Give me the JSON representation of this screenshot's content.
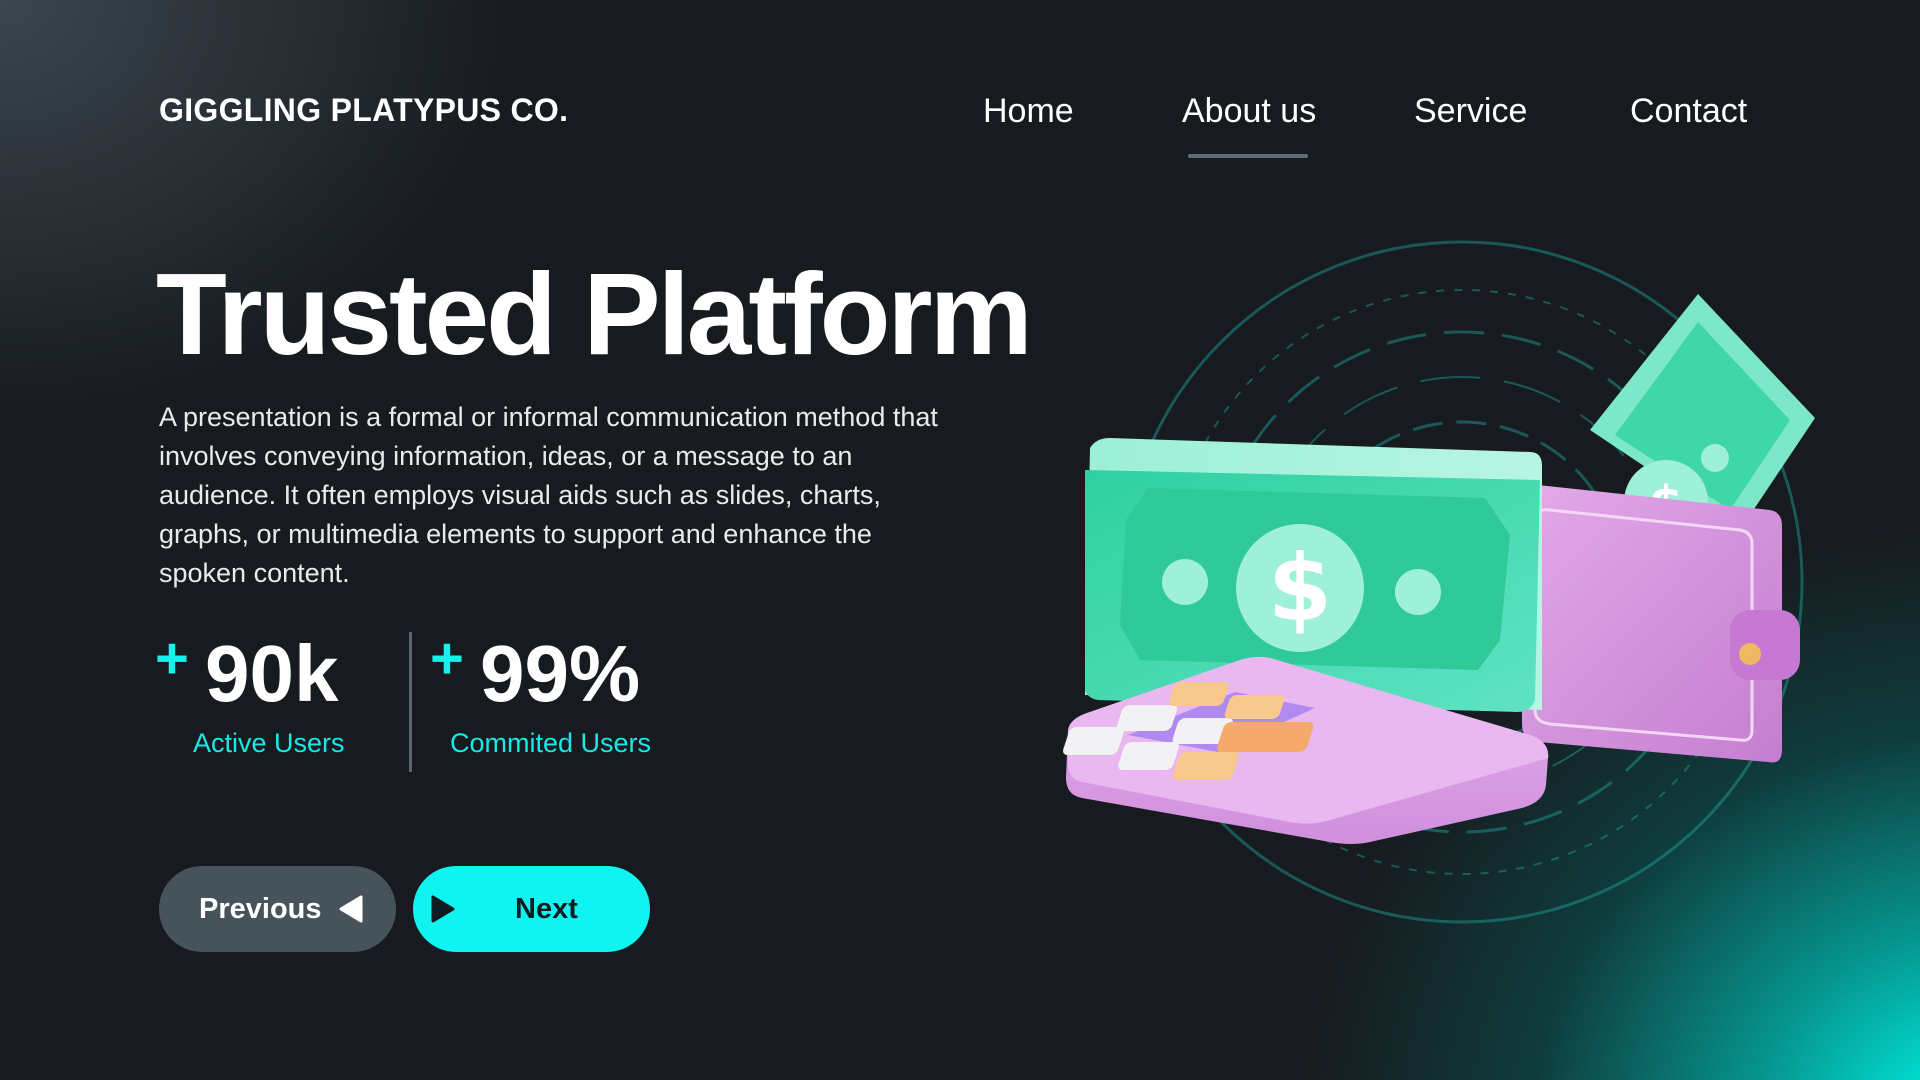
{
  "brand": {
    "name": "GIGGLING PLATYPUS CO."
  },
  "nav": {
    "items": [
      {
        "label": "Home"
      },
      {
        "label": "About us",
        "active": true
      },
      {
        "label": "Service"
      },
      {
        "label": "Contact"
      }
    ]
  },
  "hero": {
    "title": "Trusted Platform",
    "description": "A presentation is a formal or informal communication method that involves conveying information, ideas, or a message to an audience. It often employs visual aids such as slides, charts, graphs, or multimedia elements to support and enhance the spoken content."
  },
  "stats": [
    {
      "prefix": "+",
      "value": "90k",
      "label": "Active Users"
    },
    {
      "prefix": "+",
      "value": "99%",
      "label": "Commited Users"
    }
  ],
  "buttons": {
    "previous": {
      "label": "Previous",
      "icon": "triangle-left-icon"
    },
    "next": {
      "label": "Next",
      "icon": "triangle-right-icon"
    }
  },
  "colors": {
    "background": "#171b1f",
    "accent": "#10f4f1",
    "previous_button": "#47535b",
    "money_green": "#3fd6a8",
    "wallet_pink": "#d890dc"
  }
}
